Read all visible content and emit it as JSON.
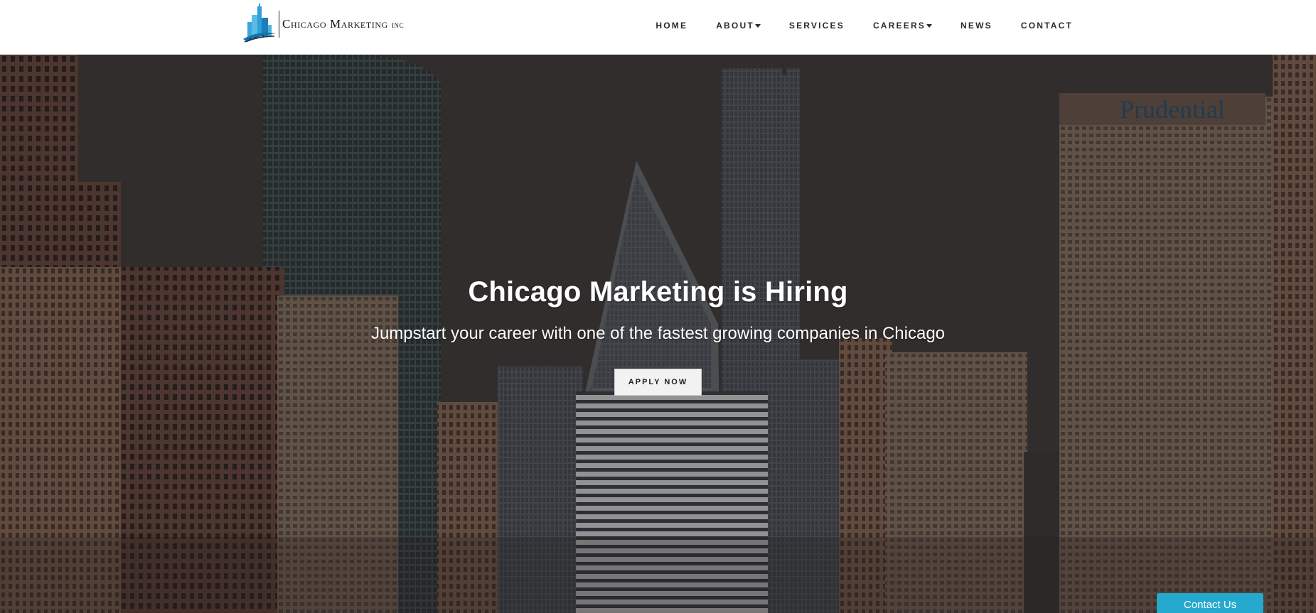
{
  "brand": {
    "name": "Chicago Marketing",
    "suffix": "inc",
    "logo_icon": "skyscraper-logo-icon"
  },
  "nav": {
    "items": [
      {
        "label": "HOME",
        "dropdown": false
      },
      {
        "label": "ABOUT",
        "dropdown": true
      },
      {
        "label": "SERVICES",
        "dropdown": false
      },
      {
        "label": "CAREERS",
        "dropdown": true
      },
      {
        "label": "NEWS",
        "dropdown": false
      },
      {
        "label": "CONTACT",
        "dropdown": false
      }
    ]
  },
  "hero": {
    "title": "Chicago Marketing is Hiring",
    "subtitle": "Jumpstart your career with one of the fastest growing companies in Chicago",
    "cta_label": "APPLY NOW",
    "background": "chicago-skyline-photo"
  },
  "floating_contact": {
    "label": "Contact Us",
    "color": "#25a9cf"
  },
  "colors": {
    "header_bg": "#ffffff",
    "nav_text": "#2a2a2a",
    "hero_text": "#ffffff",
    "cta_bg": "#f2f2f2"
  }
}
